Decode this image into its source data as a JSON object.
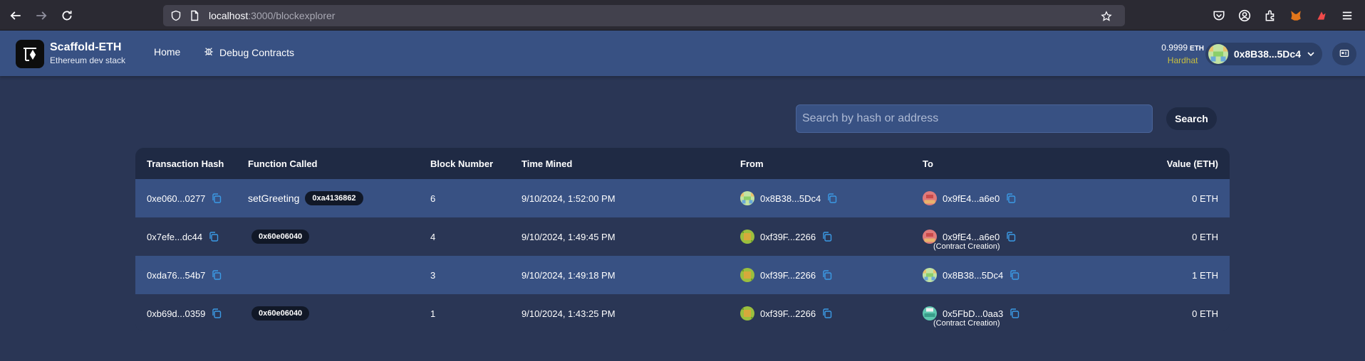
{
  "browser": {
    "url_host": "localhost",
    "url_rest": ":3000/blockexplorer"
  },
  "header": {
    "brand_title": "Scaffold-ETH",
    "brand_subtitle": "Ethereum dev stack",
    "nav": [
      {
        "label": "Home"
      },
      {
        "label": "Debug Contracts"
      }
    ],
    "balance_value": "0.9999",
    "balance_unit": "ETH",
    "network": "Hardhat",
    "network_color": "#c9bf3e",
    "account_address": "0x8B38...5Dc4"
  },
  "search": {
    "placeholder": "Search by hash or address",
    "button_label": "Search"
  },
  "table": {
    "headers": [
      "Transaction Hash",
      "Function Called",
      "Block Number",
      "Time Mined",
      "From",
      "To",
      "Value (ETH)"
    ],
    "rows": [
      {
        "hash": "0xe060...0277",
        "function": "setGreeting",
        "selector": "0xa4136862",
        "block": "6",
        "time": "9/10/2024, 1:52:00 PM",
        "from": "0x8B38...5Dc4",
        "to": "0x9fE4...a6e0",
        "to_note": "",
        "value": "0 ETH"
      },
      {
        "hash": "0x7efe...dc44",
        "function": "",
        "selector": "0x60e06040",
        "block": "4",
        "time": "9/10/2024, 1:49:45 PM",
        "from": "0xf39F...2266",
        "to": "0x9fE4...a6e0",
        "to_note": "(Contract Creation)",
        "value": "0 ETH"
      },
      {
        "hash": "0xda76...54b7",
        "function": "",
        "selector": "",
        "block": "3",
        "time": "9/10/2024, 1:49:18 PM",
        "from": "0xf39F...2266",
        "to": "0x8B38...5Dc4",
        "to_note": "",
        "value": "1 ETH"
      },
      {
        "hash": "0xb69d...0359",
        "function": "",
        "selector": "0x60e06040",
        "block": "1",
        "time": "9/10/2024, 1:43:25 PM",
        "from": "0xf39F...2266",
        "to": "0x5FbD...0aa3",
        "to_note": "(Contract Creation)",
        "value": "0 ETH"
      }
    ]
  },
  "colors": {
    "accent_copy": "#3b9be6",
    "header_bg": "#385183",
    "page_bg": "#2a3655"
  }
}
